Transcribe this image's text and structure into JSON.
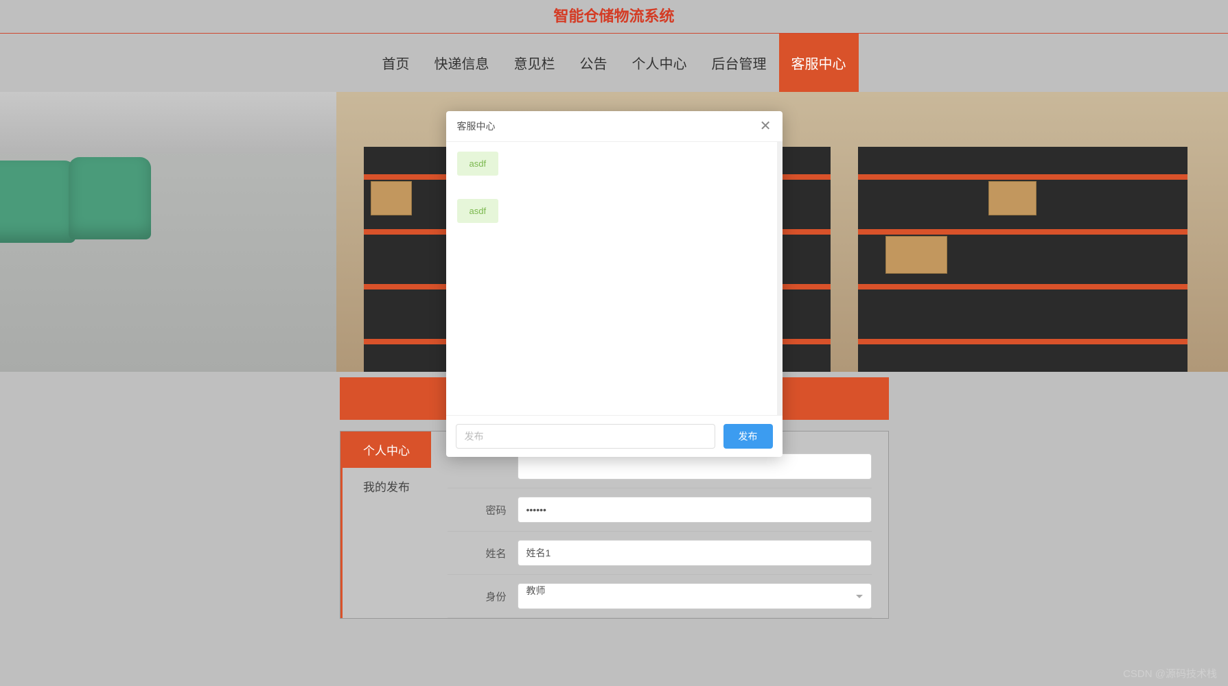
{
  "header": {
    "title": "智能仓储物流系统"
  },
  "nav": {
    "items": [
      {
        "label": "首页"
      },
      {
        "label": "快递信息"
      },
      {
        "label": "意见栏"
      },
      {
        "label": "公告"
      },
      {
        "label": "个人中心"
      },
      {
        "label": "后台管理"
      },
      {
        "label": "客服中心",
        "active": true
      }
    ]
  },
  "sidebar": {
    "items": [
      {
        "label": "个人中心",
        "active": true
      },
      {
        "label": "我的发布"
      }
    ]
  },
  "form": {
    "password_label": "密码",
    "password_value": "••••••",
    "name_label": "姓名",
    "name_value": "姓名1",
    "identity_label": "身份",
    "identity_value": "教师"
  },
  "modal": {
    "title": "客服中心",
    "messages": [
      {
        "text": "asdf"
      },
      {
        "text": "asdf"
      }
    ],
    "input_placeholder": "发布",
    "send_label": "发布"
  },
  "watermark": "CSDN @源码技术栈"
}
